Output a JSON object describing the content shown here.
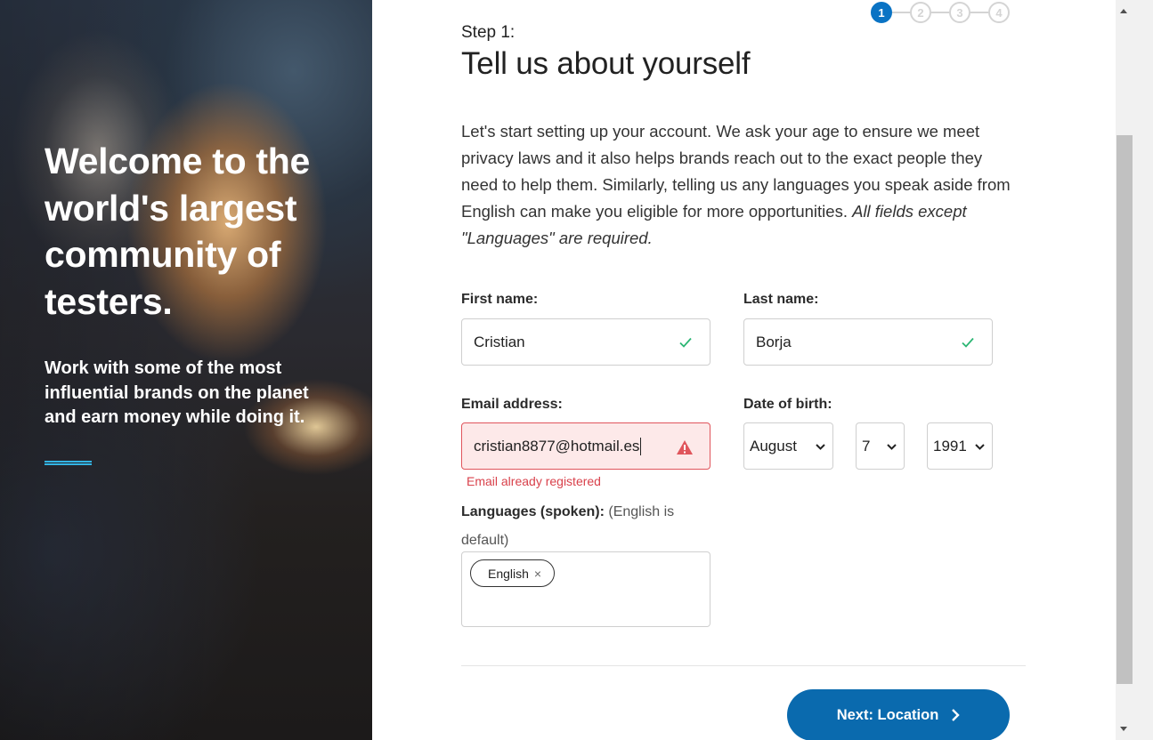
{
  "hero": {
    "title": "Welcome to the world's largest community of testers.",
    "subtitle": "Work with some of the most influential brands on the planet and earn money while doing it.",
    "accent_color": "#33b5e5"
  },
  "stepper": {
    "steps": [
      "1",
      "2",
      "3",
      "4"
    ],
    "active_step": 1,
    "active_color": "#0a73c4"
  },
  "form": {
    "step_label": "Step 1:",
    "title": "Tell us about yourself",
    "intro": "Let's start setting up your account. We ask your age to ensure we meet privacy laws and it also helps brands reach out to the exact people they need to help them. Similarly, telling us any languages you speak aside from English can make you eligible for more opportunities.",
    "intro_note": "All fields except \"Languages\" are required.",
    "first_name": {
      "label": "First name:",
      "value": "Cristian",
      "status": "valid"
    },
    "last_name": {
      "label": "Last name:",
      "value": "Borja",
      "status": "valid"
    },
    "email": {
      "label": "Email address:",
      "value": "cristian8877@hotmail.es",
      "status": "error",
      "error": "Email already registered"
    },
    "dob": {
      "label": "Date of birth:",
      "month": "August",
      "day": "7",
      "year": "1991"
    },
    "languages": {
      "label": "Languages (spoken):",
      "hint": "(English is default)",
      "tags": [
        {
          "label": "English",
          "remove": "×"
        }
      ]
    },
    "next_button": "Next: Location",
    "button_color": "#0a6aae",
    "error_color": "#d9414b",
    "valid_color": "#2bb673"
  }
}
